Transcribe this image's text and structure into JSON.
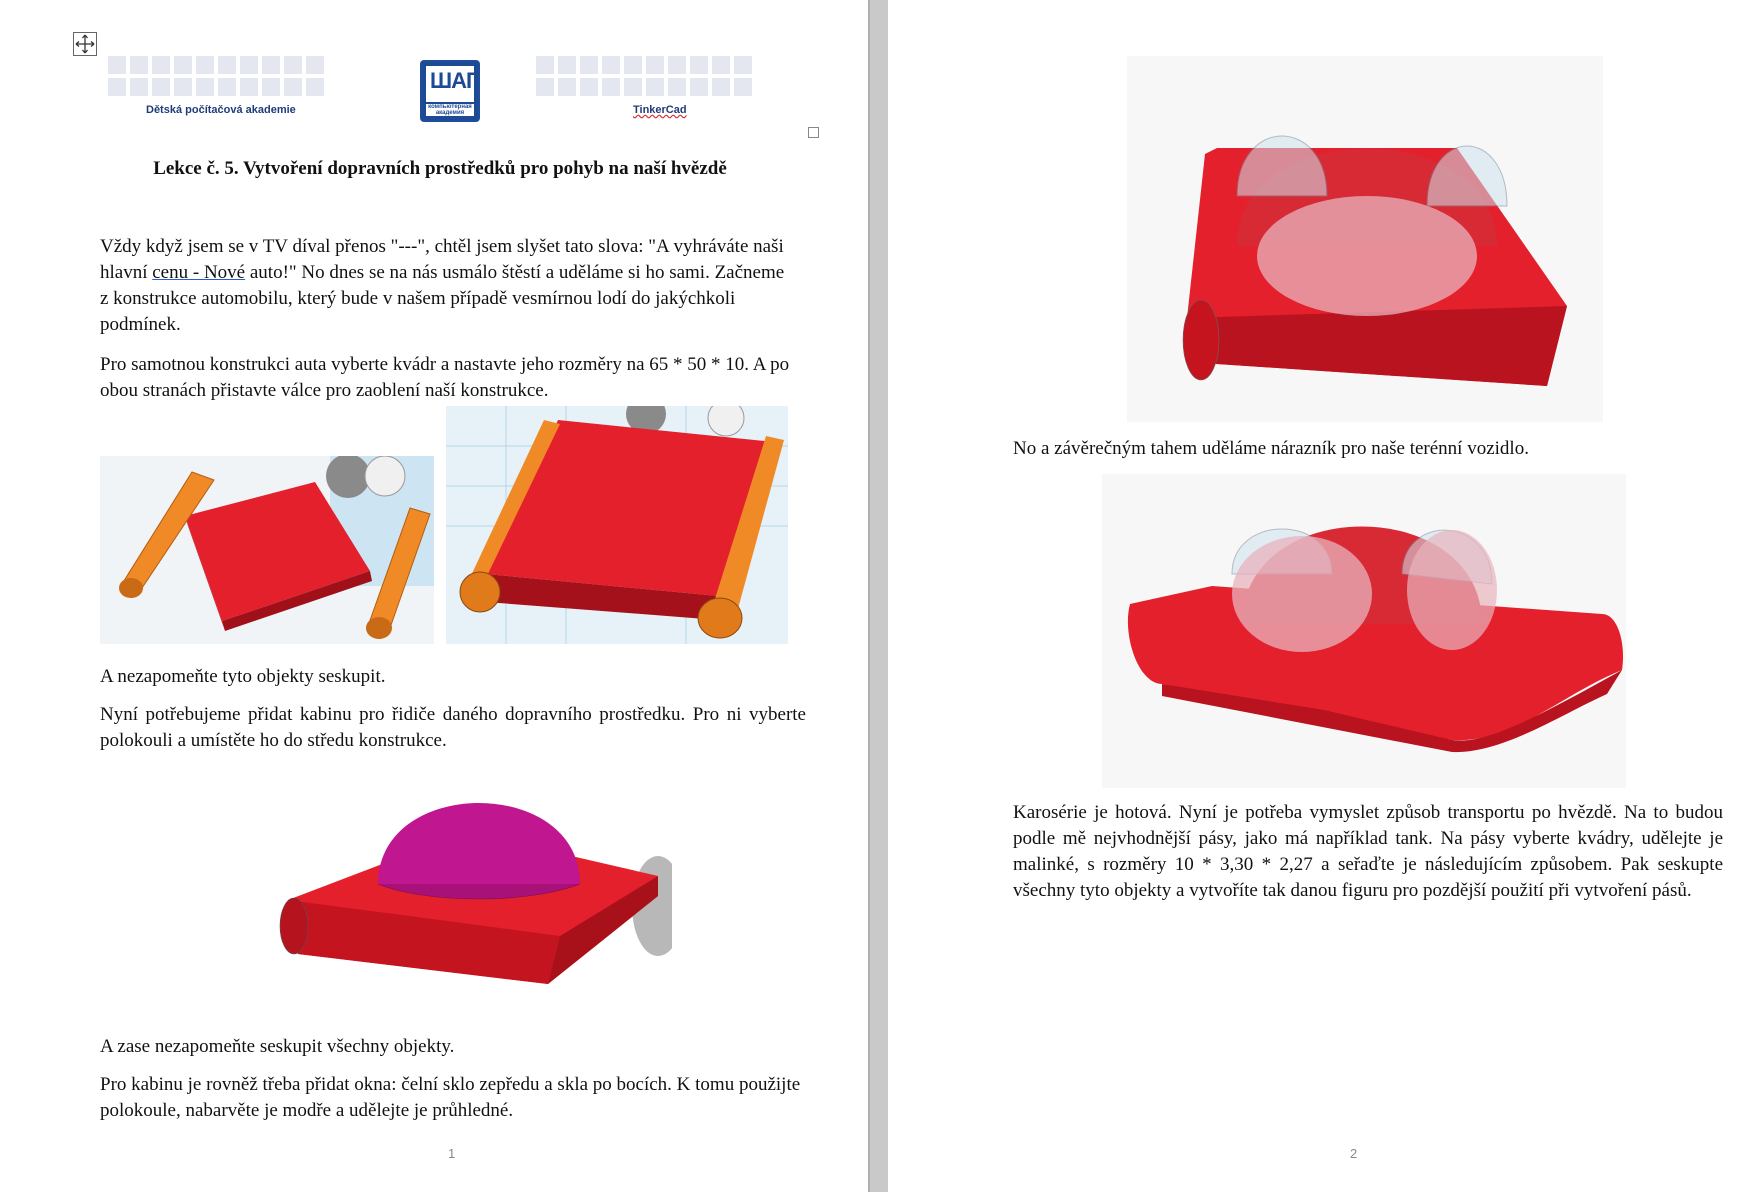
{
  "header": {
    "academy_label": "Dětská počítačová akademie",
    "tinkercad_label": "TinkerCad",
    "logo_text": "ШАГ",
    "logo_subtext": "компьютерная академия"
  },
  "lesson": {
    "title": "Lekce č. 5. Vytvoření dopravních prostředků pro pohyb na naší hvězdě"
  },
  "page1": {
    "para1_a": "Vždy když jsem se v TV díval přenos \"---\", chtěl jsem slyšet tato slova: \"A vyhráváte naši hlavní ",
    "para1_link": "cenu - Nové",
    "para1_b": " auto!\" No dnes se na nás usmálo štěstí a uděláme si ho sami. Začneme z konstrukce automobilu, který bude v našem případě vesmírnou lodí do jakýchkoli podmínek.",
    "para2": "Pro samotnou konstrukci auta vyberte kvádr a nastavte jeho rozměry na 65 * 50 * 10. A po obou stranách přistavte válce pro zaoblení naší konstrukce.",
    "para3": "A nezapomeňte tyto objekty seskupit.",
    "para4": "Nyní potřebujeme přidat kabinu pro řidiče daného dopravního prostředku. Pro ni vyberte polokouli a umístěte ho do středu konstrukce.",
    "para5": "A zase nezapomeňte seskupit všechny objekty.",
    "para6": "Pro kabinu je rovněž třeba přidat okna: čelní sklo zepředu a skla po bocích. K tomu použijte polokoule, nabarvěte je modře a udělejte je průhledné.",
    "page_number": "1"
  },
  "page2": {
    "para1": "No a závěrečným tahem uděláme nárazník pro naše terénní vozidlo.",
    "para2": "Karosérie je hotová. Nyní je potřeba vymyslet způsob transportu po hvězdě. Na to budou podle mě nejvhodnější pásy, jako má například tank. Na pásy vyberte kvádry, udělejte je malinké, s rozměry 10 * 3,30 * 2,27 a seřaďte je následujícím způsobem. Pak seskupte všechny tyto objekty a vytvoříte tak danou figuru pro pozdější použití při vytvoření pásů.",
    "page_number": "2"
  },
  "colors": {
    "body_red": "#e3202c",
    "dome_magenta": "#c0168f",
    "cylinder_orange": "#f08a26",
    "glass_blue": "#cfe3ee"
  }
}
